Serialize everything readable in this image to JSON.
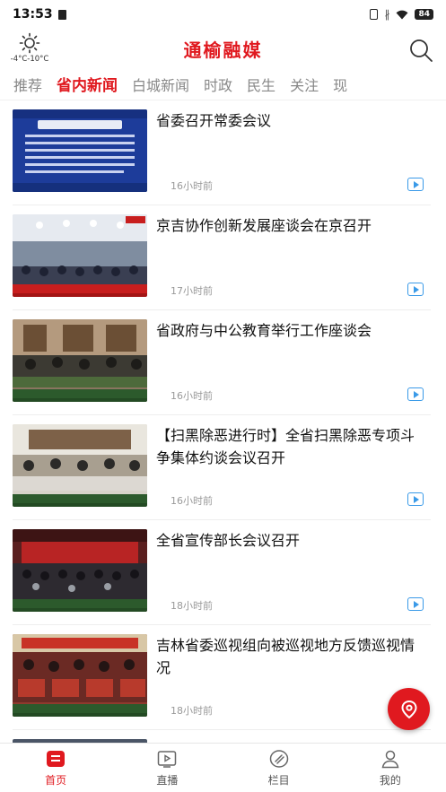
{
  "status_bar": {
    "time": "13:53",
    "battery": "84",
    "bluetooth_glyph": "∦"
  },
  "header": {
    "title": "通榆融媒",
    "weather_temp": "-4°C-10°C",
    "weather_icon": "sun-icon",
    "search_icon": "search-icon"
  },
  "tabs": [
    {
      "label": "推荐",
      "active": false
    },
    {
      "label": "省内新闻",
      "active": true
    },
    {
      "label": "白城新闻",
      "active": false
    },
    {
      "label": "时政",
      "active": false
    },
    {
      "label": "民生",
      "active": false
    },
    {
      "label": "关注",
      "active": false
    },
    {
      "label": "现",
      "active": false
    }
  ],
  "news": [
    {
      "title": "省委召开常委会议",
      "time": "16小时前",
      "thumb_caption": "省委召开常委会议"
    },
    {
      "title": "京吉协作创新发展座谈会在京召开",
      "time": "17小时前",
      "thumb_caption": "京吉协作创新发展座谈会在京召开"
    },
    {
      "title": "省政府与中公教育举行工作座谈会",
      "time": "16小时前",
      "thumb_caption": "省政府与中公教育举行工作座谈会"
    },
    {
      "title": "【扫黑除恶进行时】全省扫黑除恶专项斗争集体约谈会议召开",
      "time": "16小时前",
      "thumb_caption": "全省扫黑除恶专项斗争集体约谈会议召开"
    },
    {
      "title": "全省宣传部长会议召开",
      "time": "18小时前",
      "thumb_caption": "全省宣传部长会议召开"
    },
    {
      "title": "吉林省委巡视组向被巡视地方反馈巡视情况",
      "time": "18小时前",
      "thumb_caption": "吉林省委巡视组向被巡视地方反馈巡视情况"
    }
  ],
  "bottom_nav": [
    {
      "label": "首页",
      "icon": "home-icon",
      "active": true
    },
    {
      "label": "直播",
      "icon": "live-icon",
      "active": false
    },
    {
      "label": "栏目",
      "icon": "column-icon",
      "active": false
    },
    {
      "label": "我的",
      "icon": "profile-icon",
      "active": false
    }
  ],
  "colors": {
    "brand_red": "#e0191f",
    "video_blue": "#3a9ae8"
  }
}
